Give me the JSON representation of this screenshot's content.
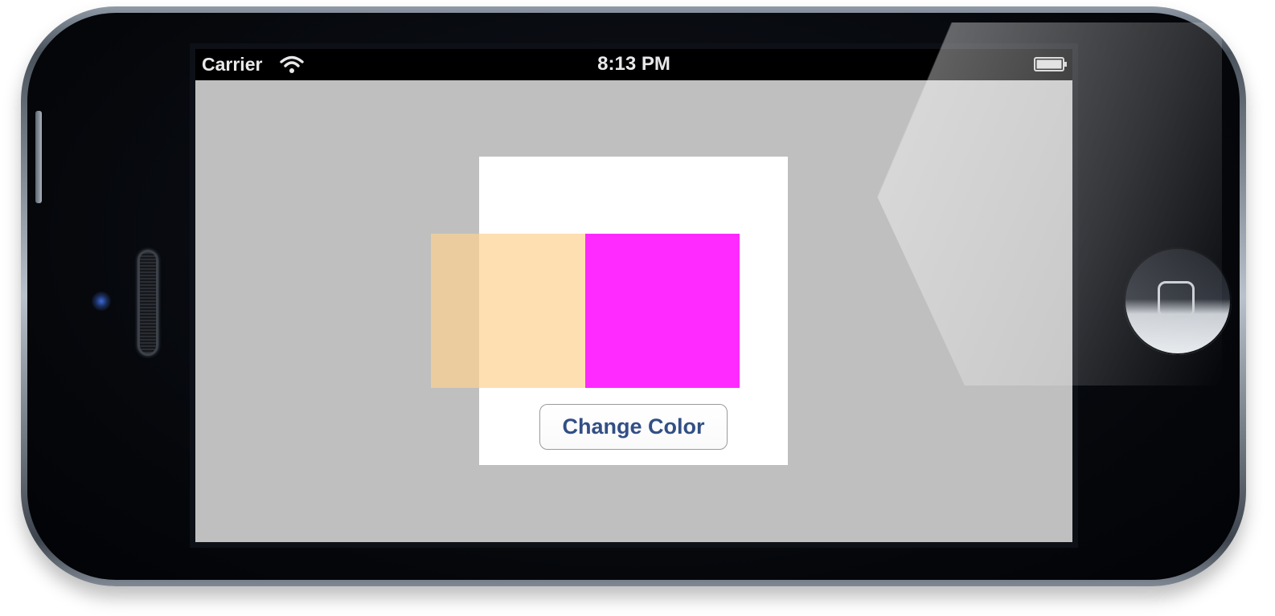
{
  "status_bar": {
    "carrier": "Carrier",
    "time": "8:13 PM",
    "icons": [
      "wifi-icon",
      "battery-icon"
    ]
  },
  "main": {
    "button_label": "Change Color"
  },
  "colors": {
    "screen_background": "#bfbfbf",
    "canvas_background": "#ffffff",
    "peach_square": "#fcd191",
    "magenta_square": "#ff2aff",
    "button_text": "#324f85"
  }
}
